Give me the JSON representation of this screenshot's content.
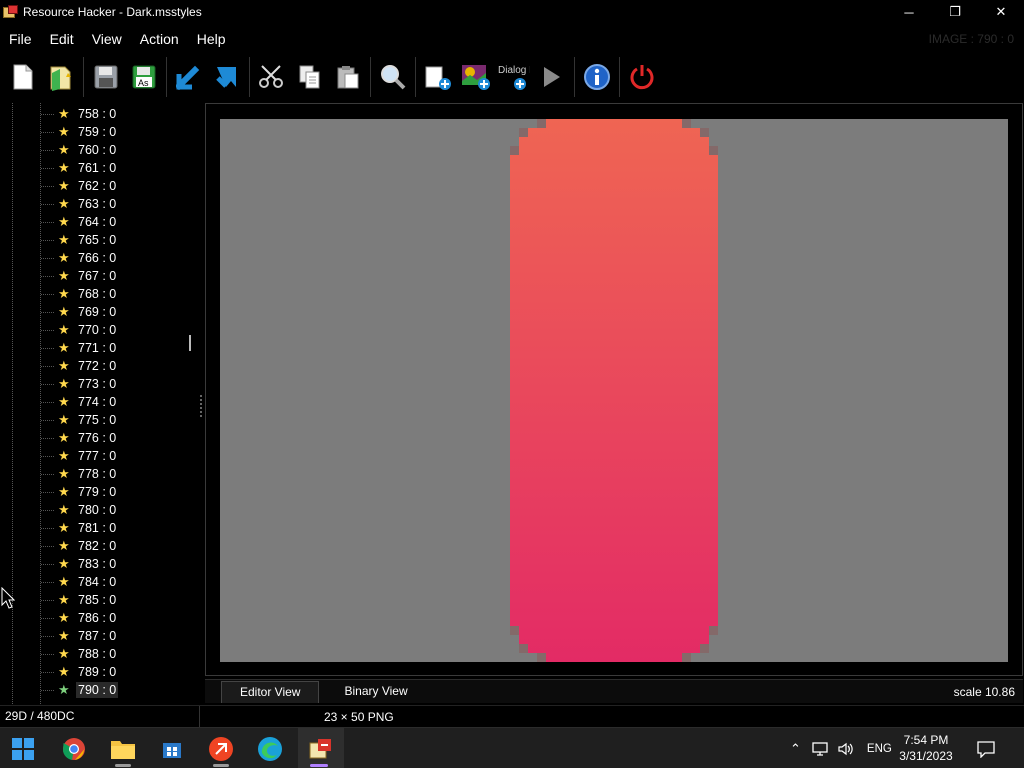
{
  "window": {
    "title": "Resource Hacker - Dark.msstyles",
    "minimize_glyph": "─",
    "maximize_glyph": "❐",
    "close_glyph": "✕"
  },
  "menu": [
    "File",
    "Edit",
    "View",
    "Action",
    "Help"
  ],
  "image_label": "IMAGE : 790 : 0",
  "toolbar": {
    "icons": [
      "new-file-icon",
      "open-file-icon",
      "save-icon",
      "save-as-icon",
      "move-down-icon",
      "bookmark-icon",
      "cut-icon",
      "copy-icon",
      "paste-icon",
      "find-icon",
      "add-resource-icon",
      "add-image-icon",
      "dialog-merger-icon",
      "run-script-icon",
      "about-icon",
      "exit-icon"
    ],
    "save_as_text": "As",
    "dialog_merger_text": "Dialog Merger"
  },
  "tree": {
    "items": [
      "758 : 0",
      "759 : 0",
      "760 : 0",
      "761 : 0",
      "762 : 0",
      "763 : 0",
      "764 : 0",
      "765 : 0",
      "766 : 0",
      "767 : 0",
      "768 : 0",
      "769 : 0",
      "770 : 0",
      "771 : 0",
      "772 : 0",
      "773 : 0",
      "774 : 0",
      "775 : 0",
      "776 : 0",
      "777 : 0",
      "778 : 0",
      "779 : 0",
      "780 : 0",
      "781 : 0",
      "782 : 0",
      "783 : 0",
      "784 : 0",
      "785 : 0",
      "786 : 0",
      "787 : 0",
      "788 : 0",
      "789 : 0",
      "790 : 0"
    ],
    "selected": "790 : 0"
  },
  "editor": {
    "tabs": [
      "Editor View",
      "Binary View"
    ],
    "active_tab": "Editor View",
    "scale": "scale 10.86",
    "background_color": "#7c7c7c",
    "image_colors": [
      "#ef6553",
      "#e32b65"
    ]
  },
  "status": {
    "left": "29D / 480DC",
    "mid": "23 × 50  PNG"
  },
  "taskbar": {
    "apps": [
      "start-icon",
      "chrome-icon",
      "file-explorer-icon",
      "store-icon",
      "anydesk-icon",
      "edge-icon",
      "resource-hacker-icon"
    ],
    "language": "ENG",
    "time": "7:54 PM",
    "date": "3/31/2023"
  }
}
